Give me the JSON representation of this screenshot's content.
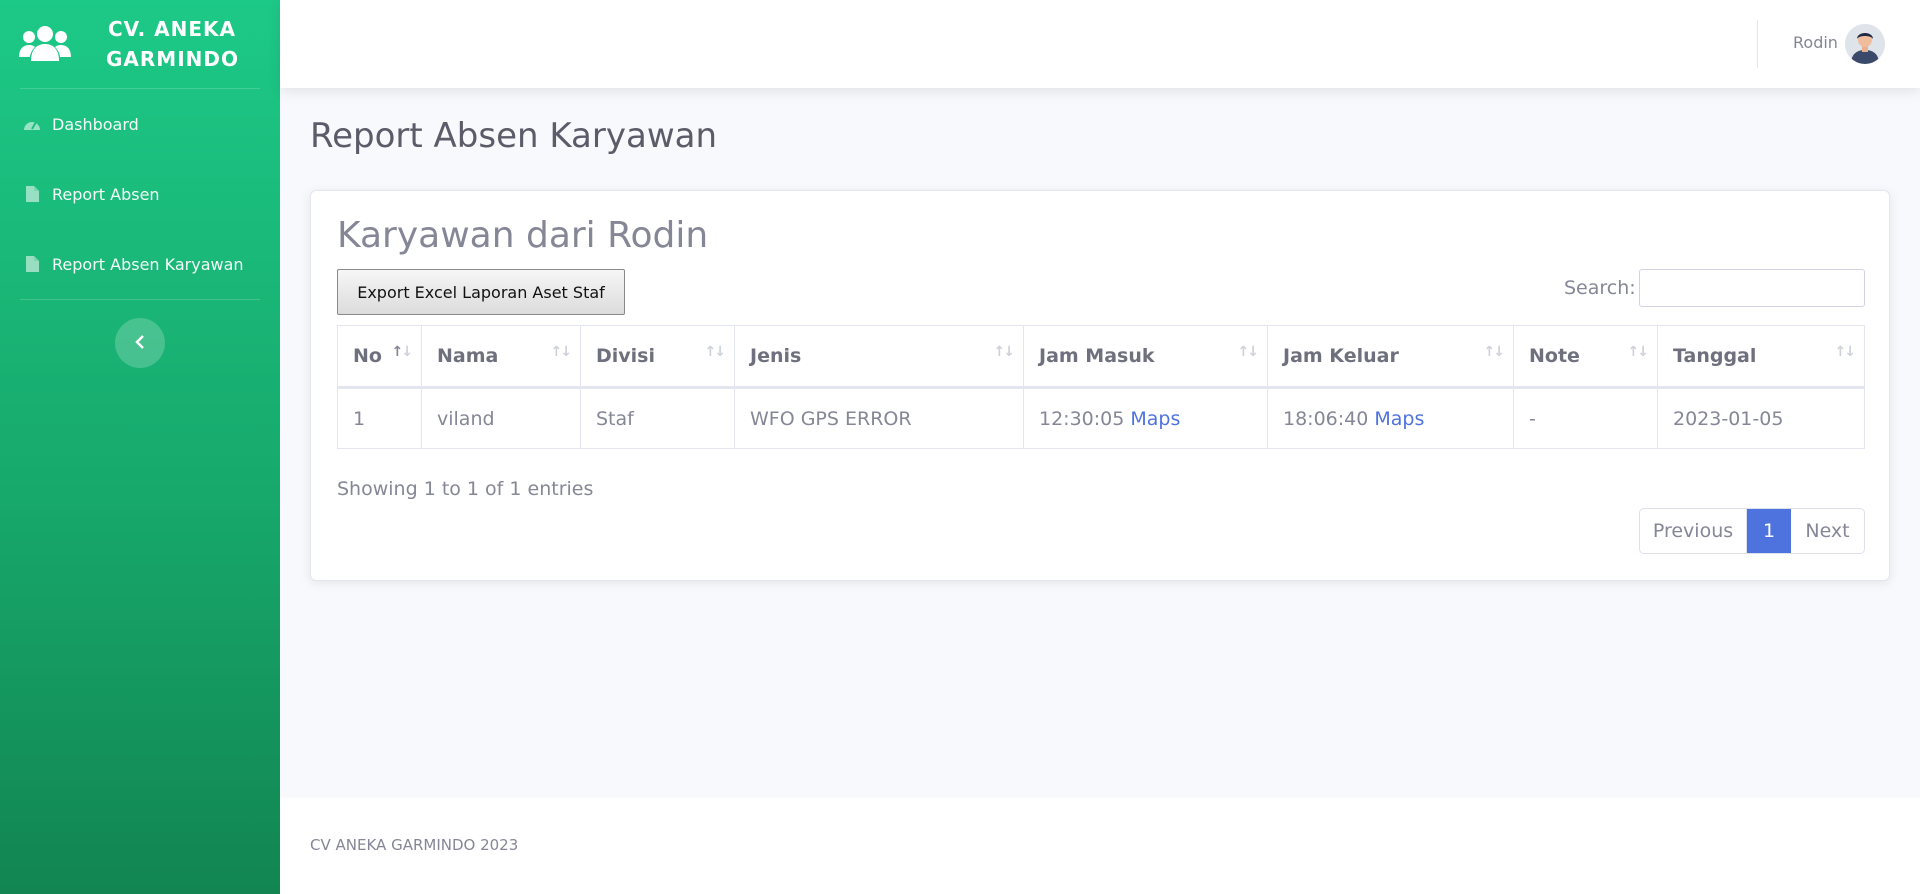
{
  "brand": {
    "line1": "CV. ANEKA",
    "line2": "GARMINDO",
    "icon": "users-icon"
  },
  "sidebar": {
    "items": [
      {
        "label": "Dashboard",
        "icon": "tachometer-icon"
      },
      {
        "label": "Report Absen",
        "icon": "file-icon"
      },
      {
        "label": "Report Absen Karyawan",
        "icon": "file-icon"
      }
    ],
    "toggle_icon": "chevron-left-icon"
  },
  "topbar": {
    "user_name": "Rodin",
    "avatar_icon": "user-avatar"
  },
  "page": {
    "title": "Report Absen Karyawan"
  },
  "card": {
    "title": "Karyawan dari Rodin",
    "export_label": "Export Excel Laporan Aset Staf",
    "search_label": "Search:",
    "search_value": ""
  },
  "table": {
    "columns": [
      "No",
      "Nama",
      "Divisi",
      "Jenis",
      "Jam Masuk",
      "Jam Keluar",
      "Note",
      "Tanggal"
    ],
    "rows": [
      {
        "no": "1",
        "nama": "viland",
        "divisi": "Staf",
        "jenis": "WFO GPS ERROR",
        "jam_masuk": "12:30:05",
        "jam_masuk_link": "Maps",
        "jam_keluar": "18:06:40",
        "jam_keluar_link": "Maps",
        "note": "-",
        "tanggal": "2023-01-05"
      }
    ]
  },
  "pagination": {
    "info": "Showing 1 to 1 of 1 entries",
    "previous": "Previous",
    "current": "1",
    "next": "Next"
  },
  "footer": {
    "text": "CV ANEKA GARMINDO 2023"
  },
  "colors": {
    "sidebar_top": "#1dc987",
    "sidebar_bottom": "#128552",
    "primary": "#4e73df"
  }
}
